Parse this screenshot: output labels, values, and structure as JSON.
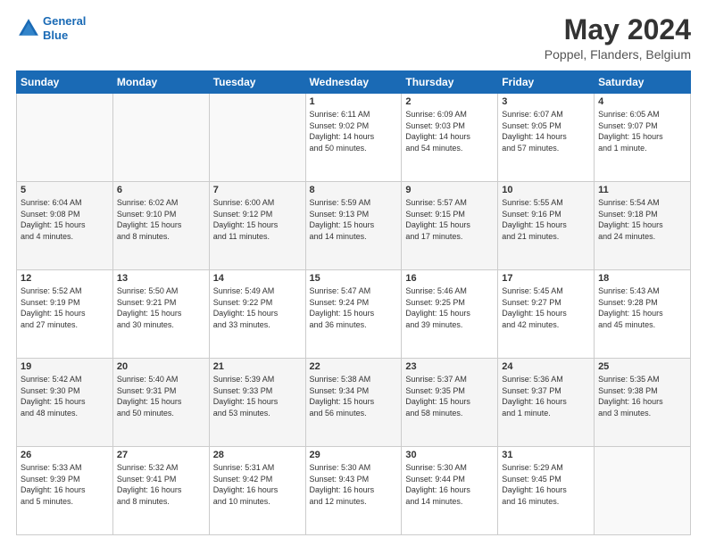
{
  "header": {
    "logo_line1": "General",
    "logo_line2": "Blue",
    "main_title": "May 2024",
    "subtitle": "Poppel, Flanders, Belgium"
  },
  "days_of_week": [
    "Sunday",
    "Monday",
    "Tuesday",
    "Wednesday",
    "Thursday",
    "Friday",
    "Saturday"
  ],
  "weeks": [
    [
      {
        "day": "",
        "info": ""
      },
      {
        "day": "",
        "info": ""
      },
      {
        "day": "",
        "info": ""
      },
      {
        "day": "1",
        "info": "Sunrise: 6:11 AM\nSunset: 9:02 PM\nDaylight: 14 hours\nand 50 minutes."
      },
      {
        "day": "2",
        "info": "Sunrise: 6:09 AM\nSunset: 9:03 PM\nDaylight: 14 hours\nand 54 minutes."
      },
      {
        "day": "3",
        "info": "Sunrise: 6:07 AM\nSunset: 9:05 PM\nDaylight: 14 hours\nand 57 minutes."
      },
      {
        "day": "4",
        "info": "Sunrise: 6:05 AM\nSunset: 9:07 PM\nDaylight: 15 hours\nand 1 minute."
      }
    ],
    [
      {
        "day": "5",
        "info": "Sunrise: 6:04 AM\nSunset: 9:08 PM\nDaylight: 15 hours\nand 4 minutes."
      },
      {
        "day": "6",
        "info": "Sunrise: 6:02 AM\nSunset: 9:10 PM\nDaylight: 15 hours\nand 8 minutes."
      },
      {
        "day": "7",
        "info": "Sunrise: 6:00 AM\nSunset: 9:12 PM\nDaylight: 15 hours\nand 11 minutes."
      },
      {
        "day": "8",
        "info": "Sunrise: 5:59 AM\nSunset: 9:13 PM\nDaylight: 15 hours\nand 14 minutes."
      },
      {
        "day": "9",
        "info": "Sunrise: 5:57 AM\nSunset: 9:15 PM\nDaylight: 15 hours\nand 17 minutes."
      },
      {
        "day": "10",
        "info": "Sunrise: 5:55 AM\nSunset: 9:16 PM\nDaylight: 15 hours\nand 21 minutes."
      },
      {
        "day": "11",
        "info": "Sunrise: 5:54 AM\nSunset: 9:18 PM\nDaylight: 15 hours\nand 24 minutes."
      }
    ],
    [
      {
        "day": "12",
        "info": "Sunrise: 5:52 AM\nSunset: 9:19 PM\nDaylight: 15 hours\nand 27 minutes."
      },
      {
        "day": "13",
        "info": "Sunrise: 5:50 AM\nSunset: 9:21 PM\nDaylight: 15 hours\nand 30 minutes."
      },
      {
        "day": "14",
        "info": "Sunrise: 5:49 AM\nSunset: 9:22 PM\nDaylight: 15 hours\nand 33 minutes."
      },
      {
        "day": "15",
        "info": "Sunrise: 5:47 AM\nSunset: 9:24 PM\nDaylight: 15 hours\nand 36 minutes."
      },
      {
        "day": "16",
        "info": "Sunrise: 5:46 AM\nSunset: 9:25 PM\nDaylight: 15 hours\nand 39 minutes."
      },
      {
        "day": "17",
        "info": "Sunrise: 5:45 AM\nSunset: 9:27 PM\nDaylight: 15 hours\nand 42 minutes."
      },
      {
        "day": "18",
        "info": "Sunrise: 5:43 AM\nSunset: 9:28 PM\nDaylight: 15 hours\nand 45 minutes."
      }
    ],
    [
      {
        "day": "19",
        "info": "Sunrise: 5:42 AM\nSunset: 9:30 PM\nDaylight: 15 hours\nand 48 minutes."
      },
      {
        "day": "20",
        "info": "Sunrise: 5:40 AM\nSunset: 9:31 PM\nDaylight: 15 hours\nand 50 minutes."
      },
      {
        "day": "21",
        "info": "Sunrise: 5:39 AM\nSunset: 9:33 PM\nDaylight: 15 hours\nand 53 minutes."
      },
      {
        "day": "22",
        "info": "Sunrise: 5:38 AM\nSunset: 9:34 PM\nDaylight: 15 hours\nand 56 minutes."
      },
      {
        "day": "23",
        "info": "Sunrise: 5:37 AM\nSunset: 9:35 PM\nDaylight: 15 hours\nand 58 minutes."
      },
      {
        "day": "24",
        "info": "Sunrise: 5:36 AM\nSunset: 9:37 PM\nDaylight: 16 hours\nand 1 minute."
      },
      {
        "day": "25",
        "info": "Sunrise: 5:35 AM\nSunset: 9:38 PM\nDaylight: 16 hours\nand 3 minutes."
      }
    ],
    [
      {
        "day": "26",
        "info": "Sunrise: 5:33 AM\nSunset: 9:39 PM\nDaylight: 16 hours\nand 5 minutes."
      },
      {
        "day": "27",
        "info": "Sunrise: 5:32 AM\nSunset: 9:41 PM\nDaylight: 16 hours\nand 8 minutes."
      },
      {
        "day": "28",
        "info": "Sunrise: 5:31 AM\nSunset: 9:42 PM\nDaylight: 16 hours\nand 10 minutes."
      },
      {
        "day": "29",
        "info": "Sunrise: 5:30 AM\nSunset: 9:43 PM\nDaylight: 16 hours\nand 12 minutes."
      },
      {
        "day": "30",
        "info": "Sunrise: 5:30 AM\nSunset: 9:44 PM\nDaylight: 16 hours\nand 14 minutes."
      },
      {
        "day": "31",
        "info": "Sunrise: 5:29 AM\nSunset: 9:45 PM\nDaylight: 16 hours\nand 16 minutes."
      },
      {
        "day": "",
        "info": ""
      }
    ]
  ]
}
